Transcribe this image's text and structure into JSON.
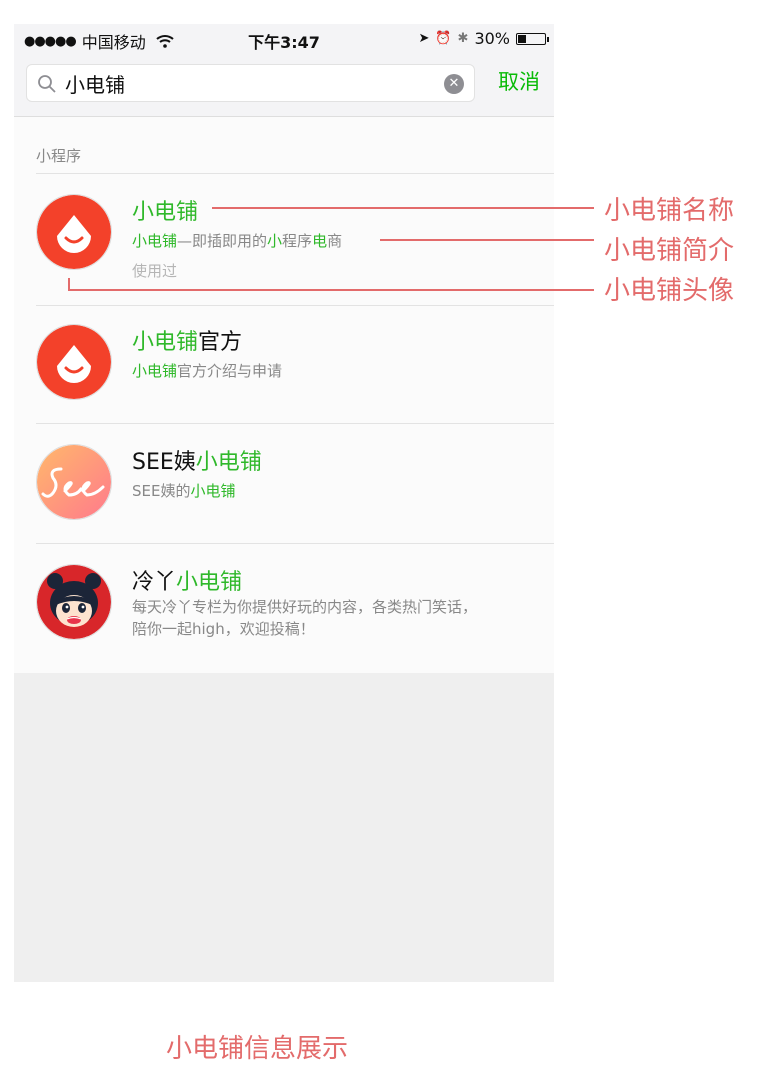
{
  "status_bar": {
    "signal": "●●●●●",
    "carrier": "中国移动",
    "time": "下午3:47",
    "battery_percent": "30%",
    "battery_level": 0.3,
    "location_icon": "➤",
    "alarm_icon": "⏰",
    "bluetooth_icon": "✱"
  },
  "search": {
    "value": "小电铺",
    "clear_icon": "✕",
    "cancel_label": "取消"
  },
  "results": {
    "section_title": "小程序",
    "items": [
      {
        "name_hl": "小电铺",
        "name_rest": "",
        "desc_parts": [
          "小电铺",
          "—即插即用的",
          "小",
          "程序",
          "电",
          "商"
        ],
        "used": "使用过"
      },
      {
        "name_hl": "小电铺",
        "name_rest": "官方",
        "desc_hl": "小电铺",
        "desc_rest": "官方介绍与申请"
      },
      {
        "name_pre": "SEE姨",
        "name_hl": "小电铺",
        "desc_pre": "SEE姨的",
        "desc_hl": "小电铺"
      },
      {
        "name_pre": "冷丫",
        "name_hl": "小电铺",
        "desc_line1": "每天冷丫专栏为你提供好玩的内容，各类热门笑话，",
        "desc_line2": "陪你一起high，欢迎投稿！"
      }
    ]
  },
  "annotations": {
    "name_label": "小电铺名称",
    "desc_label": "小电铺简介",
    "avatar_label": "小电铺头像",
    "color": "#e36b6b"
  },
  "caption": "小电铺信息展示",
  "colors": {
    "accent_green": "#2fb82a",
    "cancel_green": "#09bb07",
    "logo_red": "#f3412a"
  }
}
